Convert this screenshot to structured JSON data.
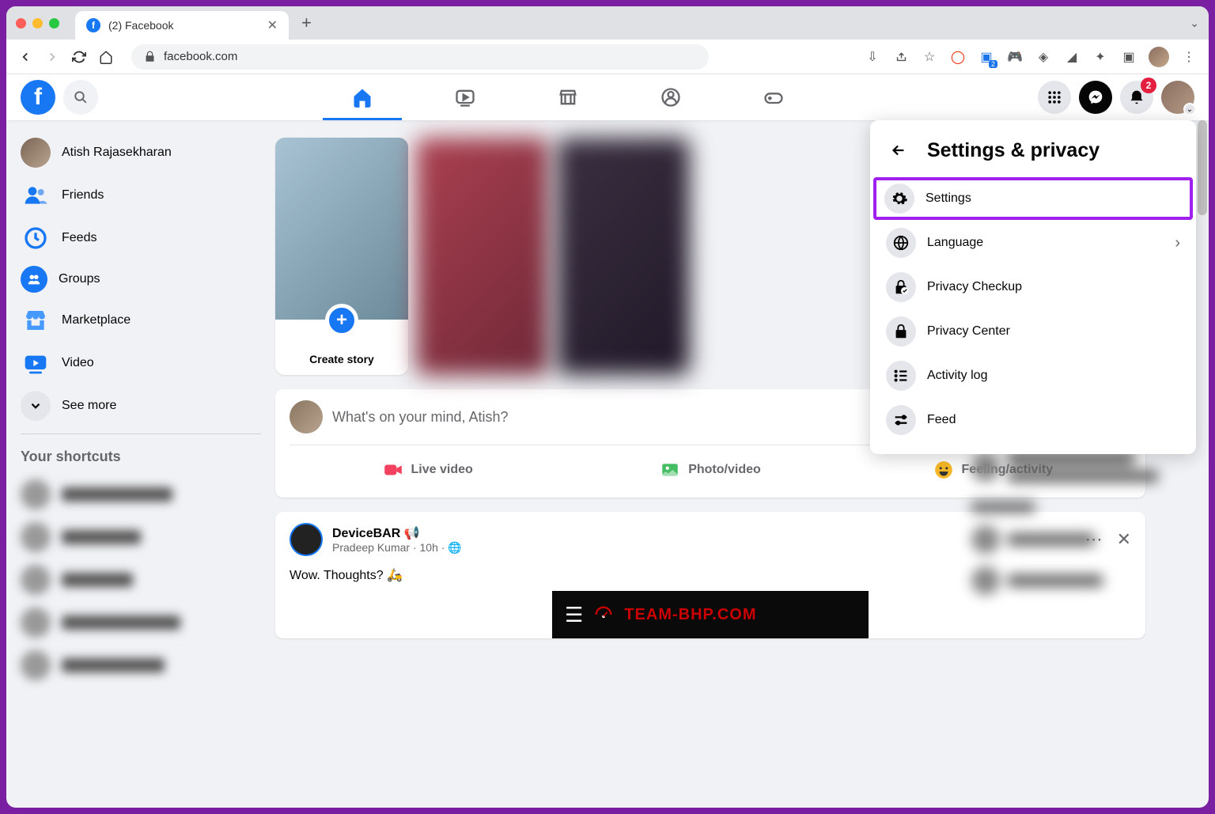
{
  "browser": {
    "tab_title": "(2) Facebook",
    "url": "facebook.com",
    "notification_badge": "2"
  },
  "header": {
    "notifications_count": "2"
  },
  "sidebar": {
    "user_name": "Atish Rajasekharan",
    "items": {
      "friends": "Friends",
      "feeds": "Feeds",
      "groups": "Groups",
      "marketplace": "Marketplace",
      "video": "Video",
      "see_more": "See more"
    },
    "shortcuts_heading": "Your shortcuts"
  },
  "stories": {
    "create_label": "Create story"
  },
  "composer": {
    "placeholder": "What's on your mind, Atish?",
    "live_video": "Live video",
    "photo_video": "Photo/video",
    "feeling": "Feeling/activity"
  },
  "post": {
    "author": "DeviceBAR 📢",
    "subline": "Pradeep Kumar · 10h · 🌐",
    "body": "Wow. Thoughts? 🛵",
    "brand": "TEAM-BHP.COM"
  },
  "dropdown": {
    "title": "Settings & privacy",
    "items": {
      "settings": "Settings",
      "language": "Language",
      "privacy_checkup": "Privacy Checkup",
      "privacy_center": "Privacy Center",
      "activity_log": "Activity log",
      "feed": "Feed"
    }
  }
}
